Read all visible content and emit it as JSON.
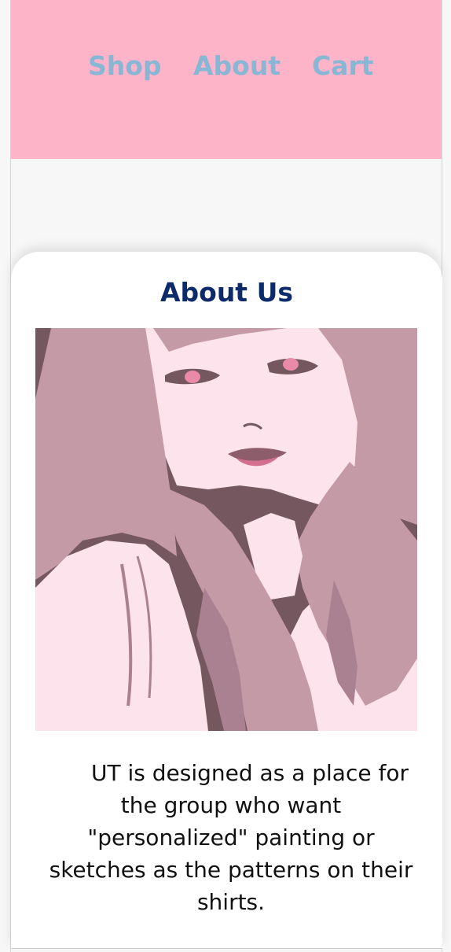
{
  "nav": {
    "shop_label": "Shop",
    "about_label": "About",
    "cart_label": "Cart"
  },
  "about": {
    "title": "About Us",
    "body": "UT is designed as a place for the group who want \"personalized\" painting or sketches as the patterns on their shirts."
  },
  "colors": {
    "nav_background": "#fdb3c8",
    "nav_link": "#88b7d6",
    "title": "#0d2a6b",
    "portrait_dark": "#75575f",
    "portrait_mid": "#c39aa6",
    "portrait_light": "#fde3ec"
  }
}
